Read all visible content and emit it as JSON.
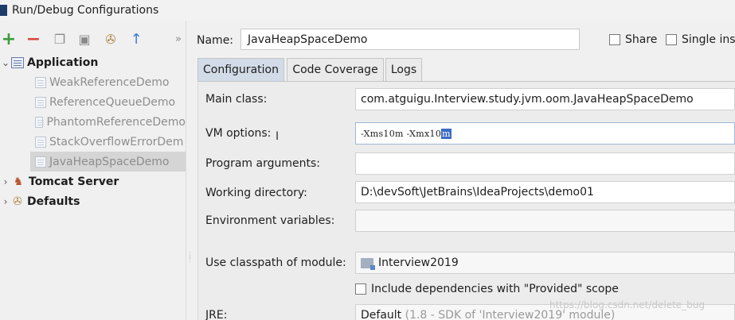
{
  "window": {
    "title": "Run/Debug Configurations"
  },
  "toolbar": {
    "add_icon": "plus-icon",
    "remove_icon": "minus-icon",
    "copy_icon": "copy-icon",
    "save_icon": "save-icon",
    "edit_defaults_icon": "wrench-icon",
    "move_up_icon": "arrow-up-icon",
    "more_glyph": "»"
  },
  "tree": {
    "application": {
      "label": "Application",
      "expanded": true,
      "children": [
        "WeakReferenceDemo",
        "ReferenceQueueDemo",
        "PhantomReferenceDemo",
        "StackOverflowErrorDem",
        "JavaHeapSpaceDemo"
      ],
      "selected_index": 4
    },
    "tomcat": {
      "label": "Tomcat Server",
      "expanded": false
    },
    "defaults": {
      "label": "Defaults",
      "expanded": false
    }
  },
  "header": {
    "name_label": "Name:",
    "name_value": "JavaHeapSpaceDemo",
    "share_label": "Share",
    "share_checked": false,
    "single_label": "Single ins",
    "single_checked": false
  },
  "tabs": [
    {
      "label": "Configuration",
      "active": true
    },
    {
      "label": "Code Coverage",
      "active": false
    },
    {
      "label": "Logs",
      "active": false
    }
  ],
  "form": {
    "main_class_label": "Main class:",
    "main_class_value": "com.atguigu.Interview.study.jvm.oom.JavaHeapSpaceDemo",
    "vm_options_label": "VM options:",
    "vm_options_value": "-Xms10m -Xmx10",
    "vm_options_selected": "m",
    "program_args_label": "Program arguments:",
    "program_args_value": "",
    "working_dir_label": "Working directory:",
    "working_dir_value": "D:\\devSoft\\JetBrains\\IdeaProjects\\demo01",
    "env_vars_label": "Environment variables:",
    "env_vars_value": "",
    "classpath_label": "Use classpath of module:",
    "classpath_value": "Interview2019",
    "include_provided_label": "Include dependencies with \"Provided\" scope",
    "include_provided_checked": false,
    "jre_label": "JRE:",
    "jre_value": "Default",
    "jre_detail": "(1.8 - SDK of 'Interview2019' module)"
  },
  "watermark": "https://blog.csdn.net/delete_bug"
}
